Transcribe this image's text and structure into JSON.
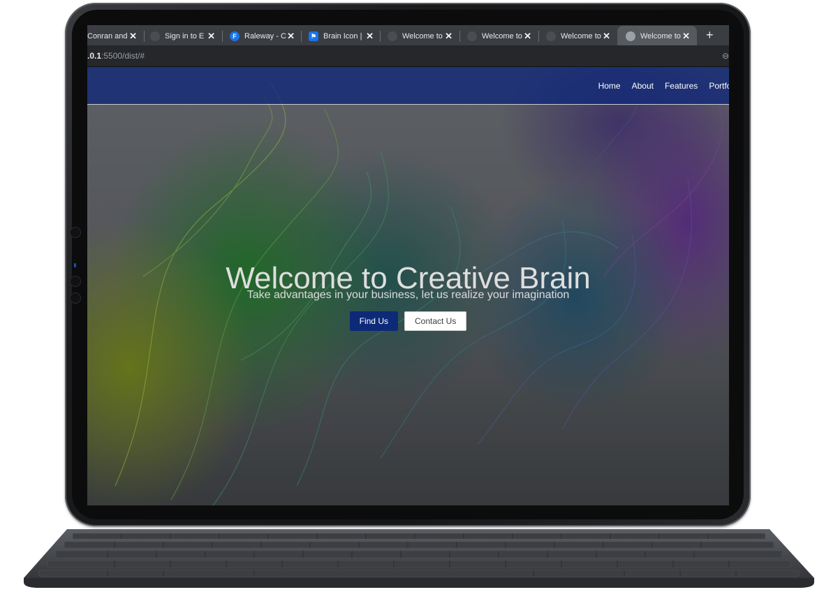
{
  "browser": {
    "tabs": [
      {
        "title": "Conran and",
        "icon": "page-icon",
        "icon_color": "#3a3d42"
      },
      {
        "title": "Sign in to E",
        "icon": "globe-icon",
        "icon_color": "#5f6368"
      },
      {
        "title": "Raleway - C",
        "icon": "google-fonts-icon",
        "icon_color": "#1a73e8",
        "icon_letter": "F"
      },
      {
        "title": "Brain Icon |",
        "icon": "flag-icon",
        "icon_color": "#1a73e8"
      },
      {
        "title": "Welcome to",
        "icon": "globe-icon",
        "icon_color": "#5f6368"
      },
      {
        "title": "Welcome to",
        "icon": "globe-icon",
        "icon_color": "#5f6368"
      },
      {
        "title": "Welcome to",
        "icon": "globe-icon",
        "icon_color": "#5f6368"
      },
      {
        "title": "Welcome to",
        "icon": "globe-icon",
        "icon_color": "#9aa0a6",
        "active": true
      }
    ],
    "close_glyph": "✕",
    "new_tab_glyph": "+",
    "url_bold": ".0.1",
    "url_rest": ":5500/dist/#"
  },
  "site": {
    "nav": [
      "Home",
      "About",
      "Features",
      "Portfol"
    ],
    "hero_title": "Welcome to Creative Brain",
    "hero_subtitle": "Take advantages in your business, let us realize your imagination",
    "primary_button": "Find Us",
    "secondary_button": "Contact Us"
  },
  "colors": {
    "navbar": "#10287a",
    "primary_button": "#0d2a78",
    "device_frame": "#1a1b1d"
  }
}
